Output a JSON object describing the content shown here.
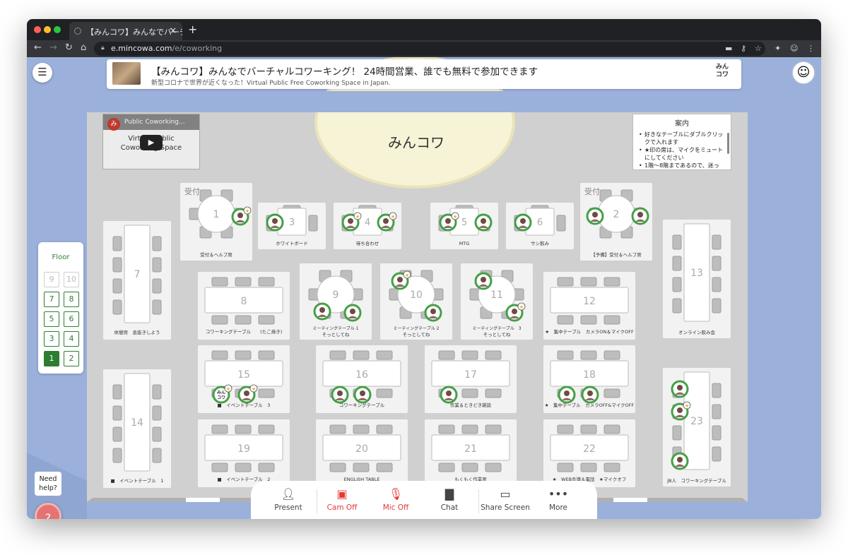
{
  "browser": {
    "tab_title": "【みんコワ】みんなでバーチ",
    "url_host": "e.mincowa.com",
    "url_path": "/e/coworking"
  },
  "banner": {
    "title": "【みんコワ】みんなでバーチャルコワーキング！ 24時間営業、誰でも無料で参加できます",
    "subtitle": "新型コロナで世界が近くなった！Virtual Public Free Coworking Space in Japan.",
    "logo_line1": "みん",
    "logo_line2": "コワ"
  },
  "map_logo": "みんコワ",
  "video": {
    "channel_initial": "み",
    "header": "Public Coworking...",
    "title": "Virtual Public\nCoworking Space"
  },
  "guide": {
    "title": "案内",
    "items": [
      "好きなテーブルにダブルクリックで入れます",
      "★印の席は、マイクをミュートにしてください",
      "1階〜8階まであるので、迷っ"
    ]
  },
  "floor": {
    "title": "Floor",
    "buttons": [
      {
        "label": "9",
        "state": "disabled"
      },
      {
        "label": "10",
        "state": "disabled"
      },
      {
        "label": "7",
        "state": "normal"
      },
      {
        "label": "8",
        "state": "normal"
      },
      {
        "label": "5",
        "state": "normal"
      },
      {
        "label": "6",
        "state": "normal"
      },
      {
        "label": "3",
        "state": "normal"
      },
      {
        "label": "4",
        "state": "normal"
      },
      {
        "label": "1",
        "state": "current"
      },
      {
        "label": "2",
        "state": "normal"
      }
    ]
  },
  "help": {
    "bubble": "Need help?",
    "icon": "question-icon"
  },
  "tables": [
    {
      "num": "1",
      "label": "受付＆ヘルプ席",
      "corner": "受付"
    },
    {
      "num": "2",
      "label": "【予備】受付＆ヘルプ席",
      "corner": "受付"
    },
    {
      "num": "3",
      "label": "ホワイトボード"
    },
    {
      "num": "4",
      "label": "待ち合わせ"
    },
    {
      "num": "5",
      "label": "MTG"
    },
    {
      "num": "6",
      "label": "サシ飲み"
    },
    {
      "num": "7",
      "label": "休憩席　息抜きしよう"
    },
    {
      "num": "8",
      "label": "コワーキングテーブル　　(たこ焼き)"
    },
    {
      "num": "9",
      "label": "ミーティングテーブル 1",
      "label2": "そっとしてね"
    },
    {
      "num": "10",
      "label": "ミーティングテーブル 2",
      "label2": "そっとしてね"
    },
    {
      "num": "11",
      "label": "ミーティングテーブル　3",
      "label2": "そっとしてね"
    },
    {
      "num": "12",
      "label": "★　集中テーブル　カメラON＆マイクOFF"
    },
    {
      "num": "13",
      "label": "オンライン飲み会"
    },
    {
      "num": "14",
      "label": "■　イベントテーブル　1"
    },
    {
      "num": "15",
      "label": "■　イベントテーブル　3"
    },
    {
      "num": "16",
      "label": "コワーキングテーブル"
    },
    {
      "num": "17",
      "label": "作業＆ときどき雑談"
    },
    {
      "num": "18",
      "label": "★　集中テーブル　カメラOFF&マイクOFF"
    },
    {
      "num": "19",
      "label": "■　イベントテーブル　2"
    },
    {
      "num": "20",
      "label": "ENGLISH TABLE"
    },
    {
      "num": "21",
      "label": "もくもく作業席"
    },
    {
      "num": "22",
      "label": "★　WEB会議＆電話　★マイクオフ"
    },
    {
      "num": "23",
      "label": "JB人　コワーキングテーブル"
    }
  ],
  "avatar_logo_text": "みん\nコワ",
  "controls": [
    {
      "label": "Present",
      "icon": "present-icon",
      "state": "normal"
    },
    {
      "label": "Cam Off",
      "icon": "cam-off-icon",
      "state": "off"
    },
    {
      "label": "Mic Off",
      "icon": "mic-off-icon",
      "state": "off"
    },
    {
      "label": "Chat",
      "icon": "chat-icon",
      "state": "normal"
    },
    {
      "label": "Share Screen",
      "icon": "share-screen-icon",
      "state": "normal"
    },
    {
      "label": "More",
      "icon": "more-icon",
      "state": "normal"
    }
  ],
  "colors": {
    "accent_green": "#2e7d32",
    "avatar_ring": "#43a047",
    "alert_red": "#e53935",
    "background": "#9bb1db"
  }
}
